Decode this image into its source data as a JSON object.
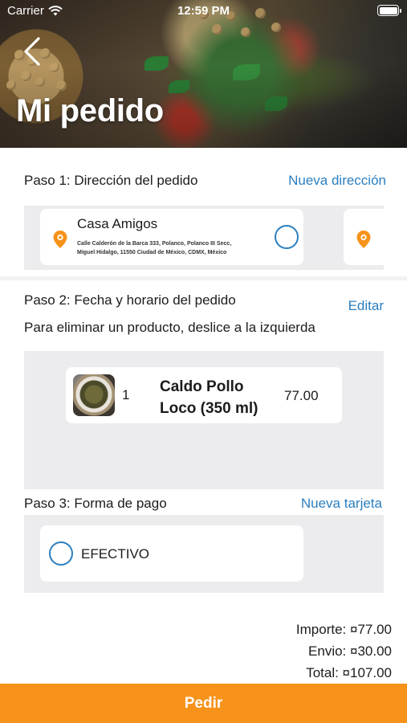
{
  "status_bar": {
    "carrier": "Carrier",
    "time": "12:59 PM"
  },
  "header": {
    "title": "Mi pedido",
    "back_icon": "chevron-left-icon"
  },
  "step1": {
    "title": "Paso 1: Dirección del pedido",
    "action": "Nueva dirección",
    "addresses": [
      {
        "name": "Casa Amigos",
        "line1": "Calle Calderón de la Barca 333, Polanco, Polanco III Secc,",
        "line2": "Miguel Hidalgo, 11550 Ciudad de México, CDMX, México",
        "selected": false
      }
    ],
    "pin_color": "#f7931a"
  },
  "step2": {
    "title": "Paso 2: Fecha y horario del pedido",
    "action": "Editar",
    "hint": "Para eliminar un producto, deslice a la izquierda",
    "products": [
      {
        "qty": "1",
        "name": "Caldo Pollo Loco (350 ml)",
        "price": "77.00"
      }
    ]
  },
  "step3": {
    "title": "Paso 3: Forma de pago",
    "action": "Nueva tarjeta",
    "methods": [
      {
        "label": "EFECTIVO",
        "selected": false
      }
    ]
  },
  "totals": {
    "importe": "Importe: ¤77.00",
    "envio": "Envio: ¤30.00",
    "total": "Total: ¤107.00"
  },
  "order_button": "Pedir",
  "colors": {
    "accent": "#f7931a",
    "link": "#2b7fc0",
    "band": "#ececee"
  }
}
